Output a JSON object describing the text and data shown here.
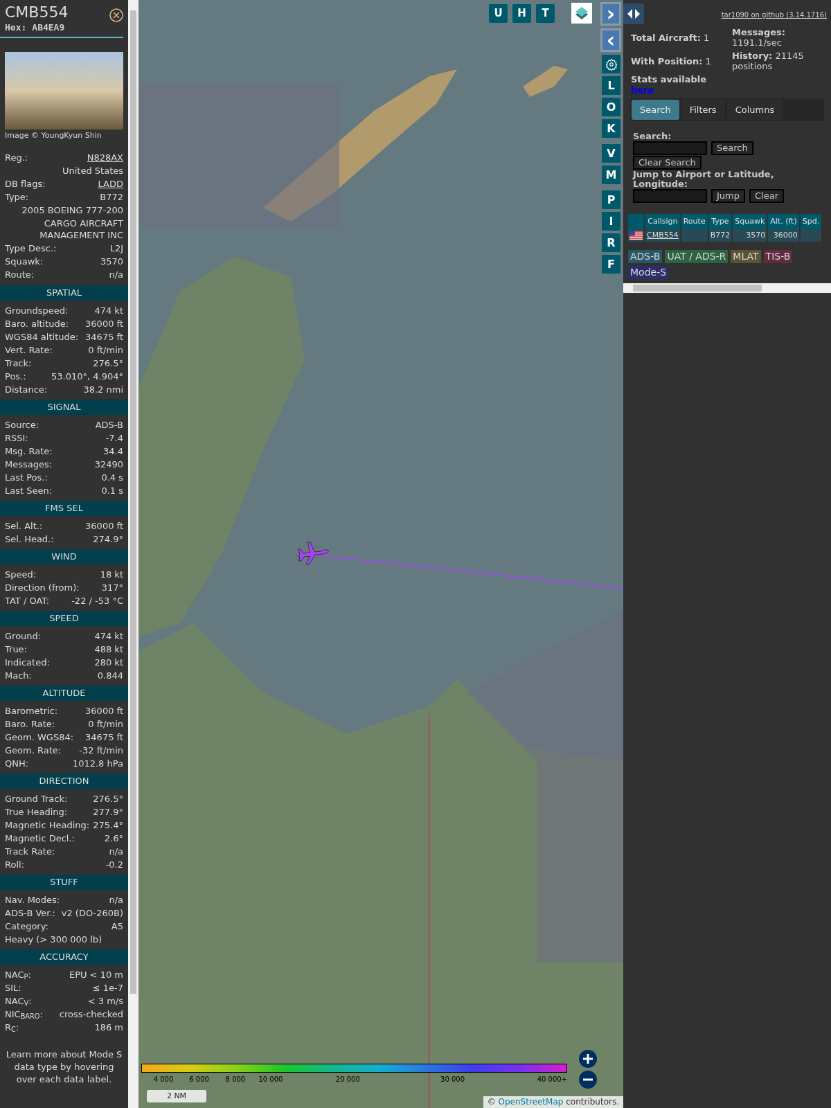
{
  "detail": {
    "callsign": "CMB554",
    "hex_label": "Hex:",
    "hex": "AB4EA9",
    "photo_credit": "Image © YoungKyun Shin",
    "rows": [
      {
        "kind": "pair",
        "label": "Reg.:",
        "value": "N828AX",
        "link": true
      },
      {
        "kind": "value",
        "value": "United States"
      },
      {
        "kind": "pair",
        "label": "DB flags:",
        "value": "LADD",
        "link": true
      },
      {
        "kind": "pair",
        "label": "Type:",
        "value": "B772",
        "link": false
      },
      {
        "kind": "value",
        "value": "2005 BOEING 777-200"
      },
      {
        "kind": "value",
        "value": "CARGO AIRCRAFT MANAGEMENT INC"
      },
      {
        "kind": "pair",
        "label": "Type Desc.:",
        "value": "L2J",
        "link": false
      },
      {
        "kind": "pair",
        "label": "Squawk:",
        "value": "3570",
        "link": false
      },
      {
        "kind": "pair",
        "label": "Route:",
        "value": "n/a",
        "link": false
      }
    ],
    "sections": [
      {
        "title": "SPATIAL",
        "rows": [
          {
            "kind": "pair",
            "label": "Groundspeed:",
            "value": "474 kt"
          },
          {
            "kind": "pair",
            "label": "Baro. altitude:",
            "value": "36000 ft"
          },
          {
            "kind": "pair",
            "label": "WGS84 altitude:",
            "value": "34675 ft"
          },
          {
            "kind": "pair",
            "label": "Vert. Rate:",
            "value": "0 ft/min"
          },
          {
            "kind": "pair",
            "label": "Track:",
            "value": "276.5°"
          },
          {
            "kind": "pair",
            "label": "Pos.:",
            "value": "53.010°, 4.904°"
          },
          {
            "kind": "pair",
            "label": "Distance:",
            "value": "38.2 nmi"
          }
        ]
      },
      {
        "title": "SIGNAL",
        "rows": [
          {
            "kind": "pair",
            "label": "Source:",
            "value": "ADS-B"
          },
          {
            "kind": "pair",
            "label": "RSSI:",
            "value": "-7.4"
          },
          {
            "kind": "pair",
            "label": "Msg. Rate:",
            "value": "34.4"
          },
          {
            "kind": "pair",
            "label": "Messages:",
            "value": "32490"
          },
          {
            "kind": "pair",
            "label": "Last Pos.:",
            "value": "0.4 s"
          },
          {
            "kind": "pair",
            "label": "Last Seen:",
            "value": "0.1 s"
          }
        ]
      },
      {
        "title": "FMS SEL",
        "rows": [
          {
            "kind": "pair",
            "label": "Sel. Alt.:",
            "value": "36000 ft"
          },
          {
            "kind": "pair",
            "label": "Sel. Head.:",
            "value": "274.9°"
          }
        ]
      },
      {
        "title": "WIND",
        "rows": [
          {
            "kind": "pair",
            "label": "Speed:",
            "value": "18 kt"
          },
          {
            "kind": "pair",
            "label": "Direction (from):",
            "value": "317°"
          },
          {
            "kind": "pair",
            "label": "TAT / OAT:",
            "value": "-22 / -53 °C"
          }
        ]
      },
      {
        "title": "SPEED",
        "rows": [
          {
            "kind": "pair",
            "label": "Ground:",
            "value": "474 kt"
          },
          {
            "kind": "pair",
            "label": "True:",
            "value": "488 kt"
          },
          {
            "kind": "pair",
            "label": "Indicated:",
            "value": "280 kt"
          },
          {
            "kind": "pair",
            "label": "Mach:",
            "value": "0.844"
          }
        ]
      },
      {
        "title": "ALTITUDE",
        "rows": [
          {
            "kind": "pair",
            "label": "Barometric:",
            "value": "36000 ft"
          },
          {
            "kind": "pair",
            "label": "Baro. Rate:",
            "value": "0 ft/min"
          },
          {
            "kind": "pair",
            "label": "Geom. WGS84:",
            "value": "34675 ft"
          },
          {
            "kind": "pair",
            "label": "Geom. Rate:",
            "value": "-32 ft/min"
          },
          {
            "kind": "pair",
            "label": "QNH:",
            "value": "1012.8 hPa"
          }
        ]
      },
      {
        "title": "DIRECTION",
        "rows": [
          {
            "kind": "pair",
            "label": "Ground Track:",
            "value": "276.5°"
          },
          {
            "kind": "pair",
            "label": "True Heading:",
            "value": "277.9°"
          },
          {
            "kind": "pair",
            "label": "Magnetic Heading:",
            "value": "275.4°"
          },
          {
            "kind": "pair",
            "label": "Magnetic Decl.:",
            "value": "2.6°"
          },
          {
            "kind": "pair",
            "label": "Track Rate:",
            "value": "n/a"
          },
          {
            "kind": "pair",
            "label": "Roll:",
            "value": "-0.2"
          }
        ]
      },
      {
        "title": "STUFF",
        "rows": [
          {
            "kind": "pair",
            "label": "Nav. Modes:",
            "value": "n/a"
          },
          {
            "kind": "pair",
            "label": "ADS-B Ver.:",
            "value": "v2 (DO-260B)"
          },
          {
            "kind": "pair",
            "label": "Category:",
            "value": "A5"
          },
          {
            "kind": "text",
            "value": "Heavy (> 300 000 lb)"
          }
        ]
      },
      {
        "title": "ACCURACY",
        "rows": [
          {
            "kind": "pair",
            "label": "NAC$_{P}$:",
            "value": "EPU < 10 m"
          },
          {
            "kind": "pair",
            "label": "SIL:",
            "value": "≤ 1e-7"
          },
          {
            "kind": "pair",
            "label": "NAC$_{V}$:",
            "value": "< 3 m/s"
          },
          {
            "kind": "pair",
            "label": "NIC$_{BARO}$:",
            "value": "cross-checked"
          },
          {
            "kind": "pair",
            "label": "R$_{C}$:",
            "value": "186 m"
          }
        ]
      }
    ],
    "note": "Learn more about Mode S data type by hovering over each data label."
  },
  "map": {
    "top_buttons": [
      "U",
      "H",
      "T"
    ],
    "side_button_groups": [
      [
        {
          "kind": "arrow",
          "label": "›"
        },
        {
          "kind": "arrow",
          "label": "‹"
        },
        {
          "kind": "gear"
        },
        {
          "kind": "letter",
          "label": "L"
        },
        {
          "kind": "letter",
          "label": "O"
        },
        {
          "kind": "letter",
          "label": "K"
        }
      ],
      [
        {
          "kind": "letter",
          "label": "V"
        },
        {
          "kind": "letter",
          "label": "M"
        }
      ],
      [
        {
          "kind": "letter",
          "label": "P"
        },
        {
          "kind": "letter",
          "label": "I"
        },
        {
          "kind": "letter",
          "label": "R"
        },
        {
          "kind": "letter",
          "label": "F"
        }
      ]
    ],
    "color_scale": [
      "4 000",
      "6 000",
      "8 000",
      "10 000",
      "20 000",
      "30 000",
      "40 000+"
    ],
    "scale": "2 NM",
    "attribution_prefix": "©",
    "attribution_link": "OpenStreetMap",
    "attribution_suffix": "contributors."
  },
  "panel": {
    "github": "tar1090 on github (3.14.1716)",
    "stats": [
      {
        "label": "Total Aircraft:",
        "value": "1"
      },
      {
        "label": "With Position:",
        "value": "1"
      },
      {
        "label": "Messages:",
        "value": "1191.1/sec"
      },
      {
        "label": "History:",
        "value": "21145 positions"
      }
    ],
    "stats_text": "Stats available",
    "stats_link": "here",
    "tabs": [
      {
        "label": "Search",
        "selected": true
      },
      {
        "label": "Filters",
        "selected": false
      },
      {
        "label": "Columns",
        "selected": false
      }
    ],
    "search_label": "Search:",
    "search_button": "Search",
    "clear_search": "Clear Search",
    "jump_label": "Jump to Airport or Latitude, Longitude:",
    "jump_button": "Jump",
    "clear_button": "Clear",
    "table": {
      "columns": [
        "Callsign",
        "Route",
        "Type",
        "Squawk",
        "Alt. (ft)",
        "Spd."
      ],
      "rows": [
        {
          "callsign": "CMB554",
          "type": "B772",
          "squawk": "3570",
          "altitude": "36000"
        }
      ]
    },
    "legend": [
      {
        "label": "ADS-B",
        "color": "#2a5767"
      },
      {
        "label": "UAT / ADS-R",
        "color": "#2c6340"
      },
      {
        "label": "MLAT",
        "color": "#5b5334"
      },
      {
        "label": "TIS-B",
        "color": "#632a42"
      },
      {
        "label": "Mode-S",
        "color": "#2e2d6c"
      }
    ]
  }
}
